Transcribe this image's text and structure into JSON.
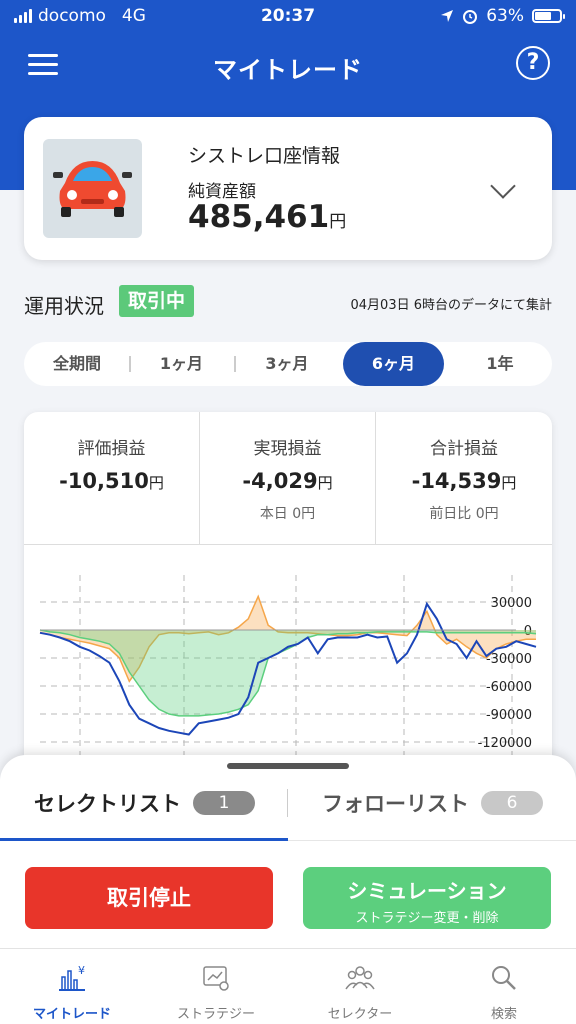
{
  "status_bar": {
    "carrier": "docomo",
    "network": "4G",
    "time": "20:37",
    "battery": "63%"
  },
  "header": {
    "title": "マイトレード",
    "help_label": "?"
  },
  "account": {
    "title": "シストレ口座情報",
    "label": "純資産額",
    "value": "485,461",
    "unit": "円"
  },
  "status": {
    "label": "運用状況",
    "badge": "取引中",
    "date_note": "04月03日 6時台のデータにて集計"
  },
  "periods": [
    {
      "label": "全期間",
      "active": false
    },
    {
      "label": "1ヶ月",
      "active": false
    },
    {
      "label": "3ヶ月",
      "active": false
    },
    {
      "label": "6ヶ月",
      "active": true
    },
    {
      "label": "1年",
      "active": false
    }
  ],
  "pl": {
    "unrealized": {
      "label": "評価損益",
      "value": "-10,510",
      "unit": "円"
    },
    "realized": {
      "label": "実現損益",
      "value": "-4,029",
      "unit": "円",
      "sub": "本日 0円"
    },
    "total": {
      "label": "合計損益",
      "value": "-14,539",
      "unit": "円",
      "sub": "前日比 0円"
    }
  },
  "chart_data": {
    "type": "line",
    "y_ticks": [
      "30000",
      "0",
      "-30000",
      "-60000",
      "-90000",
      "-120000"
    ],
    "ylim": [
      -120000,
      30000
    ],
    "grid": true,
    "series": [
      {
        "role": "unrealized",
        "style": "area",
        "color": "#f5a64a",
        "values": [
          -3000,
          -5000,
          -8000,
          -10000,
          -12000,
          -14000,
          -17000,
          -20000,
          -30000,
          -55000,
          -40000,
          -18000,
          -5000,
          -3000,
          -3000,
          -4000,
          -3000,
          -2000,
          -5000,
          -3000,
          3000,
          12000,
          36000,
          5000,
          -2000,
          -3000,
          -3000,
          -3000,
          -4000,
          -5000,
          -6000,
          -6000,
          -5000,
          -3000,
          -3000,
          -4000,
          -5000,
          -6000,
          5000,
          20000,
          -5000,
          -15000,
          -10000,
          -18000,
          -25000,
          -30000,
          -20000,
          -15000,
          -12000,
          -10000,
          -10000
        ]
      },
      {
        "role": "realized",
        "style": "area",
        "color": "#5ccf7e",
        "values": [
          0,
          -2000,
          -3000,
          -5000,
          -8000,
          -10000,
          -12000,
          -15000,
          -25000,
          -45000,
          -60000,
          -75000,
          -85000,
          -90000,
          -92000,
          -92000,
          -92000,
          -91000,
          -90000,
          -88000,
          -85000,
          -80000,
          -65000,
          -30000,
          -25000,
          -20000,
          -15000,
          -8000,
          -5000,
          -5000,
          -4000,
          -4000,
          -3000,
          -3000,
          -2000,
          -2000,
          -2000,
          -2000,
          -2000,
          -2000,
          -3000,
          -3000,
          -3000,
          -3000,
          -3000,
          -3000,
          -3000,
          -3000,
          -3000,
          -3000,
          -4000
        ]
      },
      {
        "role": "total",
        "style": "line",
        "color": "#1c46b8",
        "values": [
          -3000,
          -5000,
          -8000,
          -12000,
          -18000,
          -22000,
          -28000,
          -35000,
          -55000,
          -80000,
          -95000,
          -100000,
          -105000,
          -108000,
          -110000,
          -112000,
          -100000,
          -98000,
          -96000,
          -94000,
          -90000,
          -72000,
          -35000,
          -30000,
          -25000,
          -18000,
          -15000,
          -8000,
          -25000,
          -10000,
          -8000,
          -8000,
          -8000,
          -5000,
          -8000,
          -7000,
          -35000,
          -25000,
          -5000,
          28000,
          12000,
          -10000,
          -15000,
          -30000,
          -12000,
          -28000,
          -20000,
          -18000,
          -12000,
          -15000,
          -18000
        ]
      }
    ]
  },
  "lists": {
    "select": {
      "label": "セレクトリスト",
      "count": "1"
    },
    "follow": {
      "label": "フォローリスト",
      "count": "6"
    }
  },
  "buttons": {
    "stop": "取引停止",
    "simulation": "シミュレーション",
    "simulation_sub": "ストラテジー変更・削除"
  },
  "tabbar": [
    {
      "label": "マイトレード",
      "icon": "mytrade-chart-icon",
      "active": true
    },
    {
      "label": "ストラテジー",
      "icon": "strategy-icon",
      "active": false
    },
    {
      "label": "セレクター",
      "icon": "selector-people-icon",
      "active": false
    },
    {
      "label": "検索",
      "icon": "search-icon",
      "active": false
    }
  ],
  "colors": {
    "brand": "#1d56c9",
    "stop": "#e8352a",
    "simulation": "#5ccf7e",
    "badge": "#5cc97a"
  }
}
